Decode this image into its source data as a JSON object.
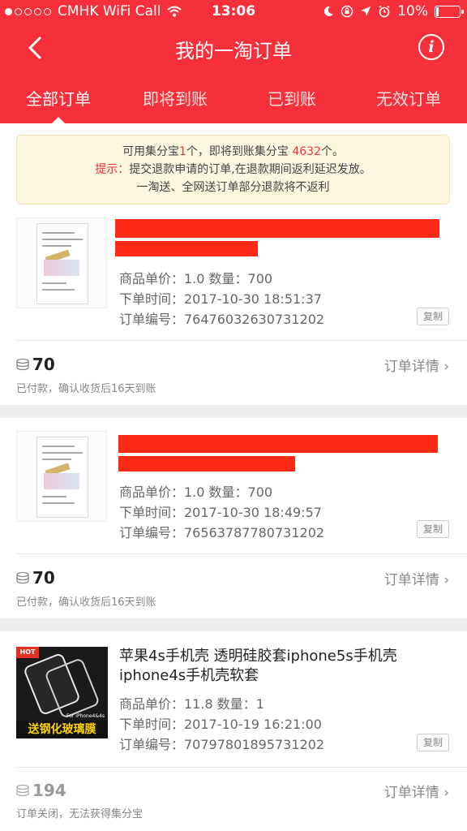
{
  "status_bar": {
    "carrier": "CMHK WiFi Call",
    "time": "13:06",
    "battery": "10%",
    "battery_level": 0.1
  },
  "nav": {
    "title": "我的一淘订单",
    "back_icon": "chevron-left-icon",
    "info_icon": "info-icon"
  },
  "tabs": [
    {
      "label": "全部订单",
      "active": true
    },
    {
      "label": "即将到账",
      "active": false
    },
    {
      "label": "已到账",
      "active": false
    },
    {
      "label": "无效订单",
      "active": false
    }
  ],
  "notice": {
    "line1_a": "可用集分宝",
    "line1_n1": "1",
    "line1_b": "个，即将到账集分宝 ",
    "line1_n2": "4632",
    "line1_c": "个。",
    "line2_label": "提示：",
    "line2_text": "提交退款申请的订单,在退款期间返利延迟发放。",
    "line3": "一淘送、全网送订单部分退款将不返利"
  },
  "orders": [
    {
      "price": "商品单价：1.0    数量：700",
      "time": "下单时间：2017-10-30 18:51:37",
      "number": "订单编号：76476032630731202",
      "copy": "复制",
      "points": "70",
      "detail": "订单详情 ›",
      "status": "已付款，确认收货后16天到账"
    },
    {
      "price": "商品单价：1.0    数量：700",
      "time": "下单时间：2017-10-30 18:49:57",
      "number": "订单编号：76563787780731202",
      "copy": "复制",
      "points": "70",
      "detail": "订单详情 ›",
      "status": "已付款，确认收货后16天到账"
    },
    {
      "title": "苹果4s手机壳 透明硅胶套iphone5s手机壳iphone4s手机壳软套",
      "image_banner": "送钢化玻璃膜",
      "image_hot": "HOT",
      "image_tag": "For iPhone4&4s",
      "price": "商品单价：11.8    数量：1",
      "time": "下单时间：2017-10-19 16:21:00",
      "number": "订单编号：70797801895731202",
      "copy": "复制",
      "points": "194",
      "detail": "订单详情 ›",
      "status": "订单关闭，无法获得集分宝"
    }
  ],
  "colors": {
    "brand": "#f5303a",
    "redaction": "#ff2a16"
  }
}
